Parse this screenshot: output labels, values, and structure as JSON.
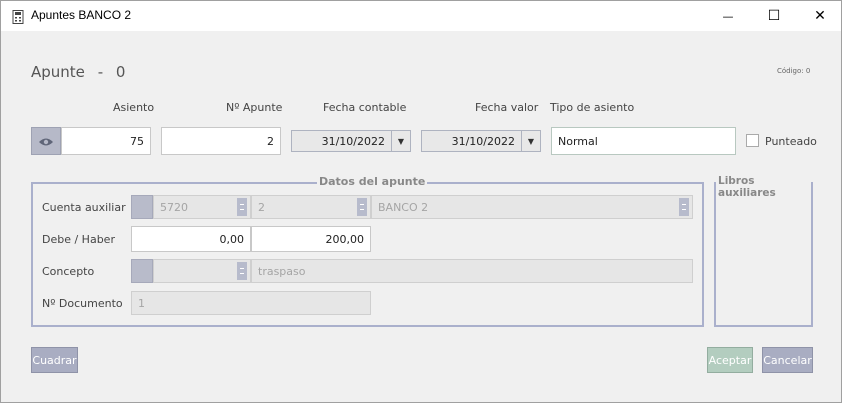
{
  "window": {
    "title": "Apuntes BANCO 2",
    "minimize_glyph": "—",
    "maximize_glyph": "☐",
    "close_glyph": "✕",
    "icon": "calculator-icon"
  },
  "header": {
    "title": "Apunte",
    "separator": "-",
    "number": "0",
    "codigo": "Código: 0"
  },
  "top_fields": {
    "asiento_label": "Asiento",
    "asiento_value": "75",
    "n_apunte_label": "Nº Apunte",
    "n_apunte_value": "2",
    "fecha_contable_label": "Fecha contable",
    "fecha_contable_value": "31/10/2022",
    "fecha_valor_label": "Fecha valor",
    "fecha_valor_value": "31/10/2022",
    "tipo_asiento_label": "Tipo de asiento",
    "tipo_asiento_value": "Normal",
    "punteado_label": "Punteado",
    "punteado_checked": false
  },
  "datos_apunte": {
    "legend": "Datos del apunte",
    "cuenta_label": "Cuenta auxiliar",
    "cuenta_code": "5720",
    "cuenta_sub": "2",
    "cuenta_name": "BANCO 2",
    "debe_haber_label": "Debe / Haber",
    "debe_value": "0,00",
    "haber_value": "200,00",
    "concepto_label": "Concepto",
    "concepto_value": "traspaso",
    "documento_label": "Nº Documento",
    "documento_value": "1"
  },
  "libros": {
    "legend": "Libros auxiliares"
  },
  "footer": {
    "cuadrar_label": "Cuadrar",
    "aceptar_label": "Aceptar",
    "cancelar_label": "Cancelar"
  },
  "colors": {
    "accent": "#a9adc2",
    "group_border": "#aab0cc",
    "accept_button": "#b3cdbf"
  }
}
